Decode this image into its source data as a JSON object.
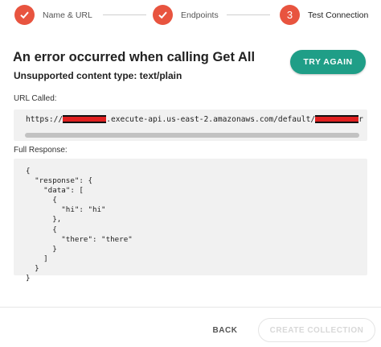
{
  "stepper": {
    "steps": [
      {
        "label": "Name & URL",
        "state": "complete",
        "icon": "check-icon"
      },
      {
        "label": "Endpoints",
        "state": "complete",
        "icon": "check-icon"
      },
      {
        "label": "Test Connection",
        "state": "active",
        "number": "3"
      }
    ]
  },
  "error": {
    "title": "An error occurred when calling Get All",
    "subtitle": "Unsupported content type: text/plain"
  },
  "actions": {
    "try_again": "TRY AGAIN",
    "back": "BACK",
    "create_collection": "CREATE COLLECTION"
  },
  "url_section": {
    "label": "URL Called:",
    "prefix": "https://",
    "middle": ".execute-api.us-east-2.amazonaws.com/default/",
    "suffix": "r"
  },
  "response_section": {
    "label": "Full Response:",
    "body": "{\n  \"response\": {\n    \"data\": [\n      {\n        \"hi\": \"hi\"\n      },\n      {\n        \"there\": \"there\"\n      }\n    ]\n  }\n}"
  },
  "colors": {
    "step_accent": "#e8543f",
    "primary_button": "#1f9e87",
    "code_background": "#f1f1f1",
    "redaction": "#e02020"
  }
}
